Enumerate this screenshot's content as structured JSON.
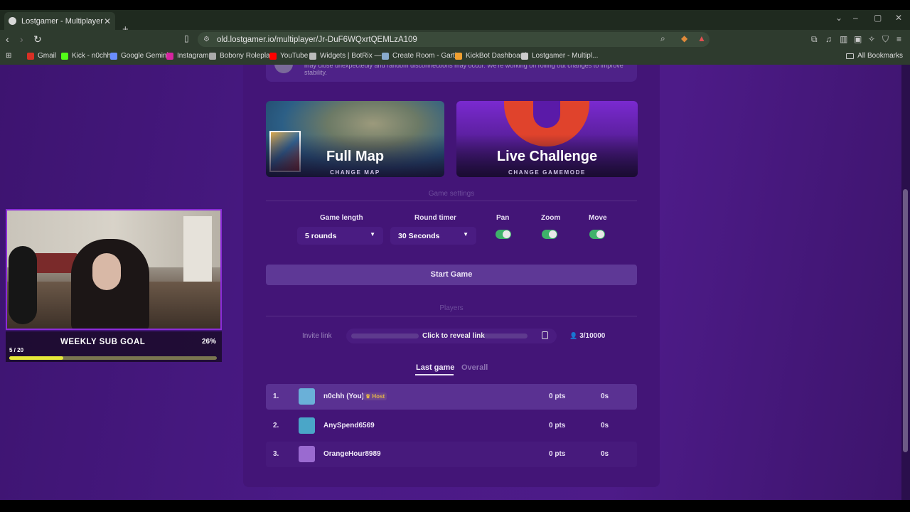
{
  "browser": {
    "tab_title": "Lostgamer - Multiplayer",
    "url": "old.lostgamer.io/multiplayer/Jr-DuF6WQxrtQEMLzA109",
    "bookmarks": [
      {
        "label": "Gmail",
        "color": "#d93025"
      },
      {
        "label": "Kick - n0chh",
        "color": "#53fc18"
      },
      {
        "label": "Google Gemini",
        "color": "#6a8dff"
      },
      {
        "label": "Instagram",
        "color": "#d6249f"
      },
      {
        "label": "Bobony Roleplay",
        "color": "#aaaaaa"
      },
      {
        "label": "YouTube",
        "color": "#ff0000"
      },
      {
        "label": "Widgets | BotRix —...",
        "color": "#bbbbbb"
      },
      {
        "label": "Create Room - Garti...",
        "color": "#88aacc"
      },
      {
        "label": "KickBot Dashboard",
        "color": "#f0a030"
      },
      {
        "label": "Lostgamer - Multipl...",
        "color": "#cccccc"
      }
    ],
    "all_bookmarks": "All Bookmarks"
  },
  "notice": {
    "text": "may close unexpectedly and random disconnections may occur. We're working on rolling out changes to improve stability."
  },
  "cards": {
    "map": {
      "title": "Full Map",
      "subtitle": "CHANGE MAP"
    },
    "mode": {
      "title": "Live Challenge",
      "subtitle": "CHANGE GAMEMODE"
    }
  },
  "settings": {
    "header": "Game settings",
    "game_length_label": "Game length",
    "game_length_value": "5 rounds",
    "round_timer_label": "Round timer",
    "round_timer_value": "30 Seconds",
    "pan_label": "Pan",
    "zoom_label": "Zoom",
    "move_label": "Move",
    "pan_on": true,
    "zoom_on": true,
    "move_on": true,
    "toggle_color": "#3eb26a"
  },
  "start_button": "Start Game",
  "players": {
    "header": "Players",
    "invite_label": "Invite link",
    "invite_action": "Click to reveal link",
    "count": "3/10000",
    "tabs": [
      "Last game",
      "Overall"
    ],
    "rows": [
      {
        "rank": "1.",
        "name": "n0chh (You)",
        "badge": "Host",
        "pts": "0 pts",
        "time": "0s",
        "avatar": "#6ab0d8"
      },
      {
        "rank": "2.",
        "name": "AnySpend6569",
        "badge": "",
        "pts": "0 pts",
        "time": "0s",
        "avatar": "#4aa6c8"
      },
      {
        "rank": "3.",
        "name": "OrangeHour8989",
        "badge": "",
        "pts": "0 pts",
        "time": "0s",
        "avatar": "#9a6ad0"
      }
    ]
  },
  "stream_overlay": {
    "goal_title": "WEEKLY SUB GOAL",
    "goal_percent": "26%",
    "goal_count": "5 / 20",
    "goal_progress": 0.26
  }
}
